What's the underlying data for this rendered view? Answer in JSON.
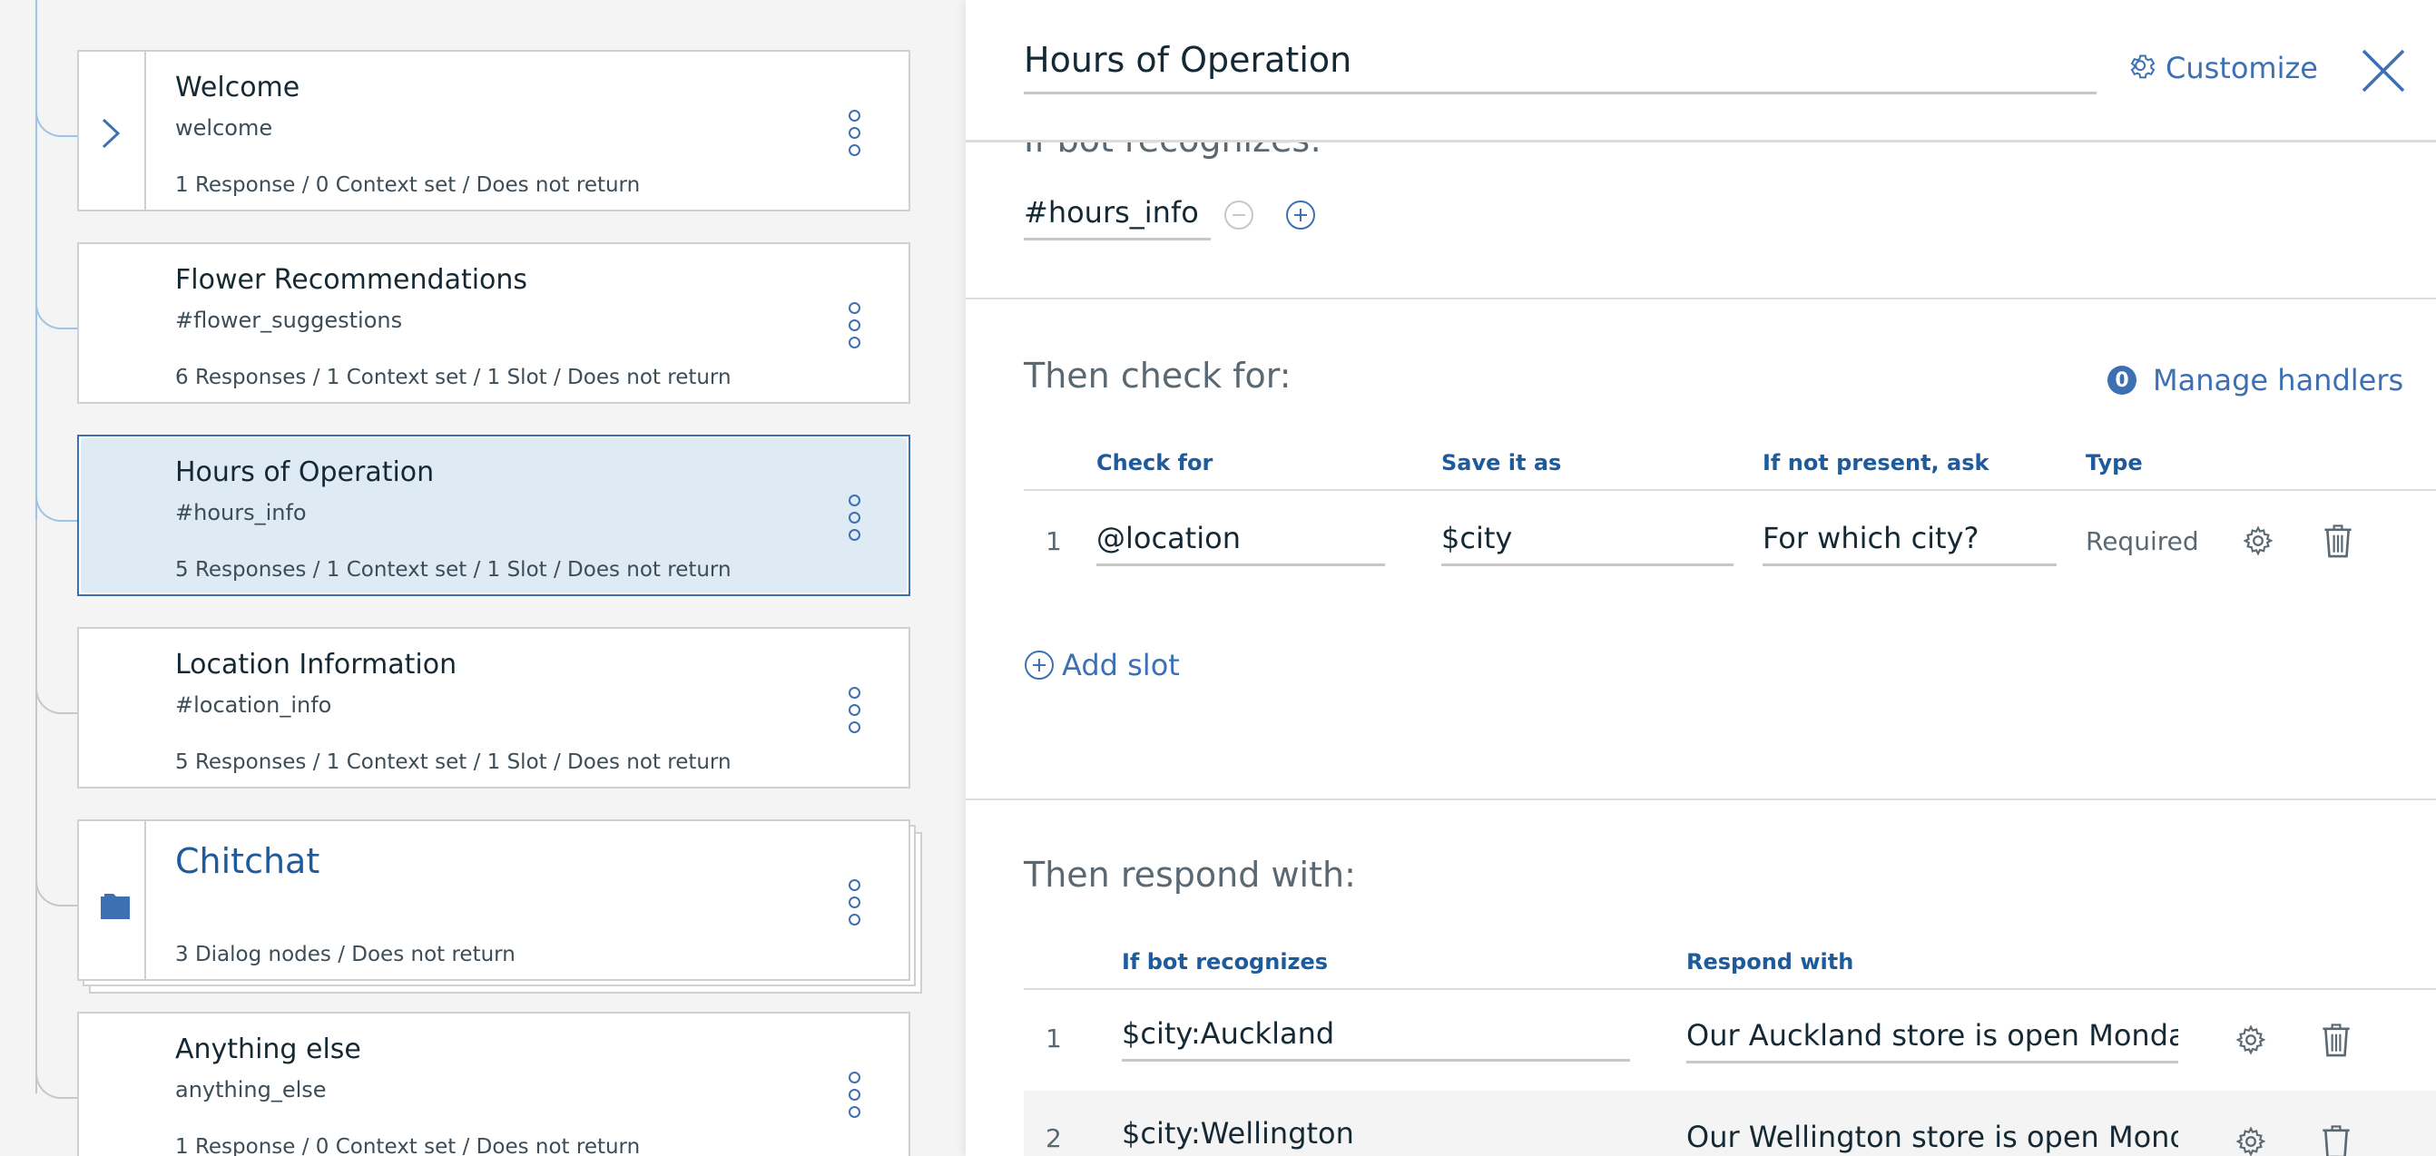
{
  "tree": {
    "nodes": [
      {
        "title": "Welcome",
        "subtitle": "welcome",
        "meta": "1 Response / 0 Context set / Does not return",
        "expandable": true
      },
      {
        "title": "Flower Recommendations",
        "subtitle": "#flower_suggestions",
        "meta": "6 Responses / 1 Context set / 1 Slot / Does not return"
      },
      {
        "title": "Hours of Operation",
        "subtitle": "#hours_info",
        "meta": "5 Responses / 1 Context set / 1 Slot / Does not return",
        "selected": true
      },
      {
        "title": "Location Information",
        "subtitle": "#location_info",
        "meta": "5 Responses / 1 Context set / 1 Slot / Does not return"
      },
      {
        "title": "Chitchat",
        "meta": "3 Dialog nodes / Does not return",
        "folder": true
      },
      {
        "title": "Anything else",
        "subtitle": "anything_else",
        "meta": "1 Response / 0 Context set / Does not return"
      }
    ]
  },
  "panel": {
    "node_name": "Hours of Operation",
    "customize_label": "Customize",
    "recognizes_heading": "If bot recognizes:",
    "intent": "#hours_info",
    "slots": {
      "heading": "Then check for:",
      "handlers_count": "0",
      "manage_handlers_label": "Manage handlers",
      "columns": [
        "Check for",
        "Save it as",
        "If not present, ask",
        "Type"
      ],
      "rows": [
        {
          "num": "1",
          "check_for": "@location",
          "save_as": "$city",
          "ask": "For which city?",
          "type": "Required"
        }
      ],
      "add_slot_label": "Add slot"
    },
    "responses": {
      "heading": "Then respond with:",
      "columns": [
        "If bot recognizes",
        "Respond with"
      ],
      "rows": [
        {
          "num": "1",
          "condition": "$city:Auckland",
          "response": "Our Auckland store is open Monday to Friday"
        },
        {
          "num": "2",
          "condition": "$city:Wellington",
          "response": "Our Wellington store is open Monday to Friday"
        }
      ]
    }
  },
  "colors": {
    "accent": "#3d70b2",
    "selected_bg": "#deebf5",
    "header_text": "#1e5b9c"
  }
}
